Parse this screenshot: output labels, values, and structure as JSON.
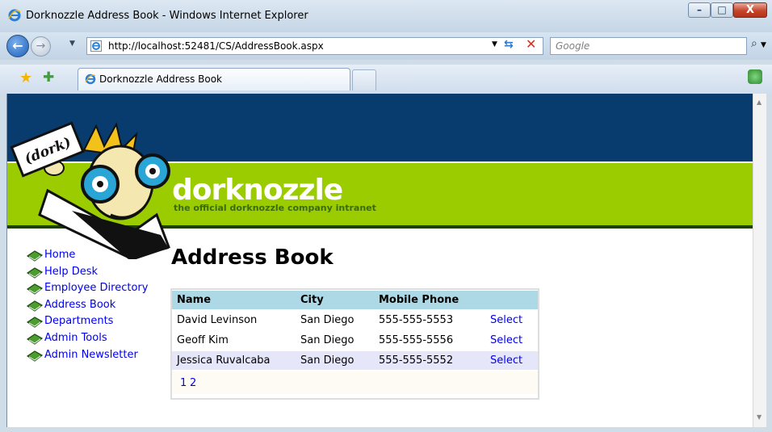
{
  "window": {
    "title": "Dorknozzle Address Book - Windows Internet Explorer",
    "minimize_glyph": "–",
    "maximize_glyph": "□",
    "close_glyph": "X"
  },
  "navigation": {
    "back_glyph": "←",
    "forward_glyph": "→",
    "history_dropdown_glyph": "▼",
    "address": "http://localhost:52481/CS/AddressBook.aspx",
    "address_dropdown_glyph": "▼",
    "refresh_glyph": "⇆",
    "stop_glyph": "✕",
    "search_placeholder": "Google",
    "search_glyph": "⌕",
    "search_dropdown_glyph": "▼"
  },
  "tabs": {
    "favorites_glyph": "★",
    "add_favorite_glyph": "✚",
    "active_tab_title": "Dorknozzle Address Book"
  },
  "header": {
    "logo_sign_text": "(dork)",
    "brand": "dorknozzle",
    "tagline": "the official dorknozzle company intranet",
    "colors": {
      "blue": "#083b6e",
      "green": "#9bcc00"
    }
  },
  "sidebar": {
    "items": [
      {
        "label": "Home"
      },
      {
        "label": "Help Desk"
      },
      {
        "label": "Employee Directory"
      },
      {
        "label": "Address Book"
      },
      {
        "label": "Departments"
      },
      {
        "label": "Admin Tools"
      },
      {
        "label": "Admin Newsletter"
      }
    ]
  },
  "main": {
    "title": "Address Book",
    "columns": [
      "Name",
      "City",
      "Mobile Phone"
    ],
    "rows": [
      {
        "name": "David Levinson",
        "city": "San Diego",
        "phone": "555-555-5553",
        "action": "Select"
      },
      {
        "name": "Geoff Kim",
        "city": "San Diego",
        "phone": "555-555-5556",
        "action": "Select"
      },
      {
        "name": "Jessica Ruvalcaba",
        "city": "San Diego",
        "phone": "555-555-5552",
        "action": "Select"
      }
    ],
    "pages": [
      "1",
      "2"
    ]
  },
  "scrollbar": {
    "up_glyph": "▲",
    "down_glyph": "▼"
  }
}
